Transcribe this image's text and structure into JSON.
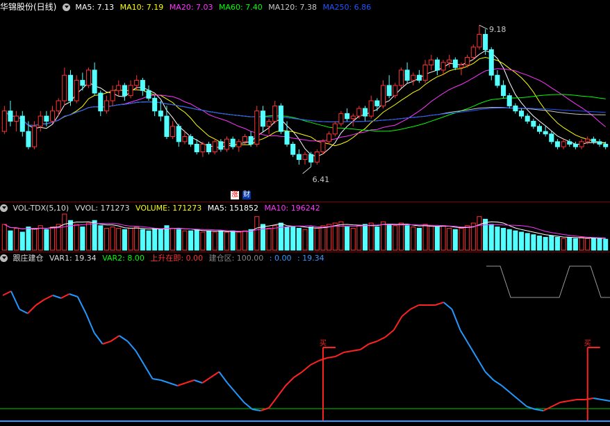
{
  "main_header": {
    "stock": "华锦股份(日线)",
    "ma5": "MA5: 7.13",
    "ma10": "MA10: 7.19",
    "ma20": "MA20: 7.03",
    "ma60": "MA60: 7.40",
    "ma120": "MA120: 7.38",
    "ma250": "MA250: 6.86"
  },
  "annotations": {
    "high": "9.18",
    "low": "6.41"
  },
  "badges": {
    "zhang": "涨",
    "cai": "财"
  },
  "vol_header": {
    "name": "VOL-TDX(5,10)",
    "vvol": "VVOL: 171273",
    "volume": "VOLUME: 171273",
    "ma5": "MA5: 151852",
    "ma10": "MA10: 196242"
  },
  "ind_header": {
    "name": "跟庄建仓",
    "var1": "VAR1: 19.34",
    "var2": "VAR2: 8.00",
    "rise": "上升在即: 0.00",
    "zone": "建仓区: 100.00",
    "v1": ": 0.00",
    "v2": ": 19.34"
  },
  "buy_label": "买",
  "colors": {
    "up": "#ff3333",
    "down": "#54ffff",
    "ma5": "#ffffff",
    "ma10": "#ffff00",
    "ma20": "#ff33ff",
    "ma60": "#00ff00",
    "ma120": "#c8c8c8",
    "ma250": "#2255ff",
    "separator": "#7a0000"
  },
  "chart_data": {
    "type": "candlestick",
    "price_axis": {
      "min": 6.0,
      "max": 9.4
    },
    "candles": [
      [
        7.1,
        7.6,
        7.05,
        7.5
      ],
      [
        7.5,
        7.7,
        7.2,
        7.3
      ],
      [
        7.3,
        7.5,
        7.1,
        7.4
      ],
      [
        7.4,
        7.5,
        7.0,
        7.1
      ],
      [
        7.1,
        7.3,
        6.75,
        6.8
      ],
      [
        6.8,
        7.3,
        6.75,
        7.2
      ],
      [
        7.2,
        7.5,
        7.1,
        7.4
      ],
      [
        7.4,
        7.5,
        7.2,
        7.3
      ],
      [
        7.3,
        7.6,
        7.25,
        7.5
      ],
      [
        7.5,
        7.75,
        7.4,
        7.7
      ],
      [
        7.7,
        8.35,
        7.6,
        8.2
      ],
      [
        8.2,
        8.3,
        7.6,
        7.7
      ],
      [
        7.7,
        8.2,
        7.65,
        8.1
      ],
      [
        8.1,
        8.25,
        7.9,
        8.0
      ],
      [
        8.0,
        8.35,
        7.95,
        8.3
      ],
      [
        8.3,
        8.45,
        7.8,
        7.85
      ],
      [
        7.85,
        7.9,
        7.4,
        7.5
      ],
      [
        7.5,
        7.8,
        7.45,
        7.7
      ],
      [
        7.7,
        8.0,
        7.6,
        7.9
      ],
      [
        7.9,
        8.1,
        7.8,
        8.0
      ],
      [
        8.0,
        8.05,
        7.7,
        7.8
      ],
      [
        7.8,
        8.1,
        7.75,
        8.0
      ],
      [
        8.0,
        8.2,
        7.9,
        8.1
      ],
      [
        8.1,
        8.15,
        7.8,
        7.9
      ],
      [
        7.9,
        8.0,
        7.7,
        7.75
      ],
      [
        7.75,
        7.8,
        7.4,
        7.5
      ],
      [
        7.5,
        7.7,
        7.3,
        7.4
      ],
      [
        7.4,
        7.6,
        6.95,
        7.0
      ],
      [
        7.0,
        7.3,
        6.95,
        7.2
      ],
      [
        7.2,
        7.25,
        6.8,
        6.9
      ],
      [
        6.9,
        7.1,
        6.85,
        7.0
      ],
      [
        7.0,
        7.05,
        6.8,
        6.85
      ],
      [
        6.85,
        6.95,
        6.65,
        6.7
      ],
      [
        6.7,
        6.9,
        6.6,
        6.85
      ],
      [
        6.85,
        6.9,
        6.65,
        6.7
      ],
      [
        6.7,
        6.95,
        6.65,
        6.9
      ],
      [
        6.9,
        6.95,
        6.7,
        6.75
      ],
      [
        6.75,
        7.0,
        6.7,
        6.95
      ],
      [
        6.95,
        7.0,
        6.75,
        6.8
      ],
      [
        6.8,
        6.95,
        6.7,
        6.9
      ],
      [
        6.9,
        7.05,
        6.85,
        7.0
      ],
      [
        7.0,
        7.1,
        6.8,
        6.85
      ],
      [
        6.85,
        7.6,
        6.8,
        7.5
      ],
      [
        7.5,
        7.6,
        7.1,
        7.2
      ],
      [
        7.2,
        7.35,
        7.05,
        7.3
      ],
      [
        7.3,
        7.7,
        7.25,
        7.6
      ],
      [
        7.6,
        7.65,
        7.05,
        7.1
      ],
      [
        7.1,
        7.3,
        6.8,
        6.85
      ],
      [
        6.85,
        6.9,
        6.6,
        6.65
      ],
      [
        6.65,
        6.75,
        6.45,
        6.55
      ],
      [
        6.55,
        6.7,
        6.45,
        6.65
      ],
      [
        6.65,
        6.7,
        6.41,
        6.5
      ],
      [
        6.5,
        6.75,
        6.45,
        6.7
      ],
      [
        6.7,
        6.95,
        6.65,
        6.9
      ],
      [
        6.9,
        7.1,
        6.85,
        7.05
      ],
      [
        7.05,
        7.3,
        7.0,
        7.25
      ],
      [
        7.25,
        7.5,
        7.2,
        7.45
      ],
      [
        7.45,
        7.55,
        7.3,
        7.35
      ],
      [
        7.35,
        7.45,
        7.2,
        7.4
      ],
      [
        7.4,
        7.6,
        7.35,
        7.55
      ],
      [
        7.55,
        7.6,
        7.3,
        7.4
      ],
      [
        7.4,
        7.8,
        7.35,
        7.7
      ],
      [
        7.7,
        7.75,
        7.5,
        7.6
      ],
      [
        7.6,
        8.1,
        7.55,
        8.0
      ],
      [
        8.0,
        8.2,
        7.75,
        7.8
      ],
      [
        7.8,
        8.05,
        7.75,
        8.0
      ],
      [
        8.0,
        8.35,
        7.95,
        8.3
      ],
      [
        8.3,
        8.45,
        8.05,
        8.1
      ],
      [
        8.1,
        8.25,
        8.0,
        8.2
      ],
      [
        8.2,
        8.3,
        8.05,
        8.1
      ],
      [
        8.1,
        8.5,
        8.05,
        8.4
      ],
      [
        8.4,
        8.6,
        8.3,
        8.5
      ],
      [
        8.5,
        8.55,
        8.2,
        8.3
      ],
      [
        8.3,
        8.5,
        8.2,
        8.45
      ],
      [
        8.45,
        8.6,
        8.35,
        8.5
      ],
      [
        8.5,
        8.55,
        8.3,
        8.35
      ],
      [
        8.35,
        8.45,
        8.2,
        8.4
      ],
      [
        8.4,
        8.6,
        8.35,
        8.55
      ],
      [
        8.55,
        8.8,
        8.5,
        8.75
      ],
      [
        8.75,
        9.18,
        8.7,
        9.0
      ],
      [
        9.0,
        9.1,
        8.6,
        8.7
      ],
      [
        8.7,
        8.75,
        8.1,
        8.2
      ],
      [
        8.2,
        8.3,
        7.95,
        8.0
      ],
      [
        8.0,
        8.1,
        7.75,
        7.8
      ],
      [
        7.8,
        7.85,
        7.55,
        7.6
      ],
      [
        7.6,
        7.65,
        7.45,
        7.5
      ],
      [
        7.5,
        7.55,
        7.35,
        7.4
      ],
      [
        7.4,
        7.45,
        7.25,
        7.3
      ],
      [
        7.3,
        7.35,
        7.15,
        7.2
      ],
      [
        7.2,
        7.25,
        7.05,
        7.1
      ],
      [
        7.1,
        7.2,
        7.0,
        7.05
      ],
      [
        7.05,
        7.1,
        6.85,
        6.9
      ],
      [
        6.9,
        6.95,
        6.75,
        6.8
      ],
      [
        6.8,
        6.95,
        6.75,
        6.9
      ],
      [
        6.9,
        6.95,
        6.8,
        6.85
      ],
      [
        6.85,
        6.9,
        6.75,
        6.8
      ],
      [
        6.8,
        6.95,
        6.75,
        6.9
      ],
      [
        6.9,
        7.0,
        6.85,
        6.95
      ],
      [
        6.95,
        7.0,
        6.85,
        6.9
      ],
      [
        6.9,
        6.95,
        6.8,
        6.85
      ],
      [
        6.85,
        6.9,
        6.75,
        6.8
      ]
    ],
    "volumes": [
      200,
      150,
      170,
      140,
      180,
      170,
      190,
      160,
      180,
      200,
      280,
      230,
      200,
      180,
      210,
      230,
      190,
      170,
      180,
      170,
      160,
      170,
      180,
      160,
      150,
      170,
      160,
      190,
      170,
      160,
      150,
      150,
      160,
      140,
      150,
      140,
      150,
      140,
      150,
      140,
      150,
      160,
      260,
      200,
      170,
      190,
      210,
      180,
      180,
      170,
      160,
      180,
      170,
      190,
      200,
      210,
      220,
      180,
      170,
      190,
      200,
      210,
      180,
      220,
      200,
      190,
      210,
      190,
      180,
      170,
      200,
      190,
      180,
      190,
      170,
      160,
      170,
      190,
      210,
      260,
      240,
      200,
      180,
      170,
      160,
      150,
      140,
      130,
      120,
      110,
      100,
      110,
      100,
      90,
      100,
      90,
      100,
      90,
      95,
      90,
      85
    ],
    "indicator": {
      "var1_range": [
        0,
        100
      ],
      "buy_bars": [
        53,
        97
      ],
      "var1": [
        85,
        88,
        75,
        72,
        78,
        82,
        85,
        83,
        86,
        84,
        72,
        58,
        50,
        52,
        56,
        52,
        45,
        35,
        25,
        24,
        22,
        20,
        22,
        24,
        22,
        26,
        30,
        22,
        15,
        8,
        3,
        2,
        4,
        12,
        20,
        26,
        30,
        35,
        38,
        40,
        41,
        44,
        45,
        46,
        50,
        52,
        55,
        60,
        70,
        75,
        78,
        78,
        78,
        80,
        75,
        60,
        50,
        40,
        30,
        24,
        20,
        15,
        10,
        5,
        3,
        2,
        5,
        8,
        9,
        10,
        10,
        11,
        10,
        9
      ]
    }
  }
}
